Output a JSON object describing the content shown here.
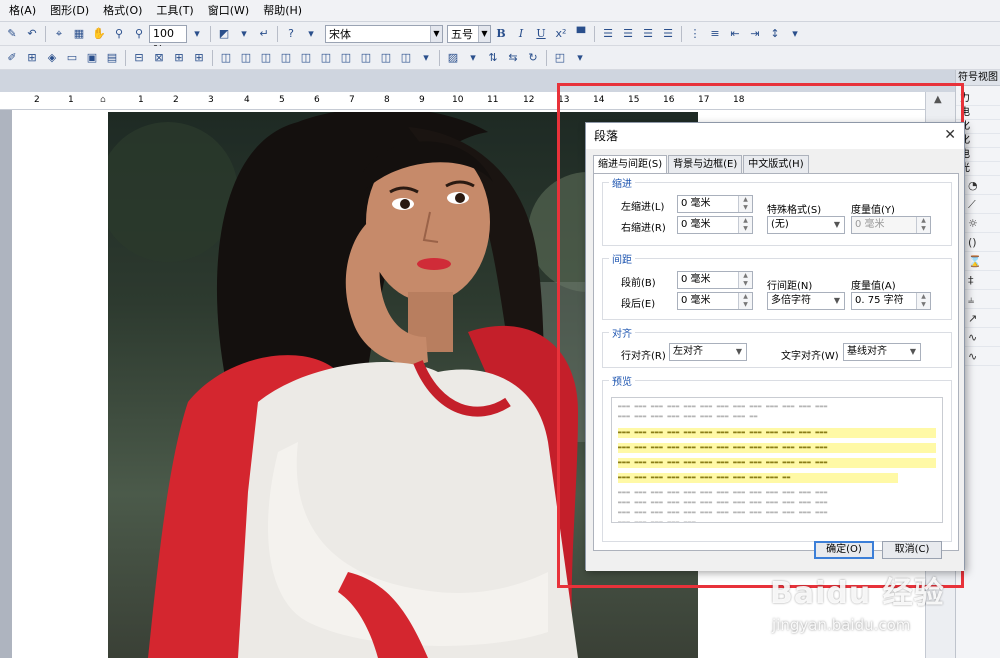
{
  "menu": [
    "格(A)",
    "图形(D)",
    "格式(O)",
    "工具(T)",
    "窗口(W)",
    "帮助(H)"
  ],
  "toolbar": {
    "zoom": "100 %",
    "font_name": "宋体",
    "font_size": "五号",
    "bold": "B",
    "italic": "I",
    "underline": "U"
  },
  "ruler_ticks": [
    "2",
    "1",
    "",
    "1",
    "2",
    "3",
    "4",
    "5",
    "6",
    "7",
    "8",
    "9",
    "10",
    "11",
    "12",
    "13",
    "14",
    "15",
    "16",
    "17",
    "18"
  ],
  "right_panel": {
    "title": "符号视图",
    "items": [
      "力",
      "电",
      "化",
      "化",
      "电",
      "光"
    ]
  },
  "dialog": {
    "title": "段落",
    "tabs": [
      "缩进与间距(S)",
      "背景与边框(E)",
      "中文版式(H)"
    ],
    "indent": {
      "group": "缩进",
      "left_label": "左缩进(L)",
      "left_value": "0 毫米",
      "right_label": "右缩进(R)",
      "right_value": "0 毫米",
      "special_label": "特殊格式(S)",
      "special_value": "(无)",
      "measure_label": "度量值(Y)",
      "measure_value": "0 毫米"
    },
    "spacing": {
      "group": "间距",
      "before_label": "段前(B)",
      "before_value": "0 毫米",
      "after_label": "段后(E)",
      "after_value": "0 毫米",
      "line_label": "行间距(N)",
      "line_value": "多倍字符",
      "measure_label": "度量值(A)",
      "measure_value": "0. 75 字符"
    },
    "align": {
      "group": "对齐",
      "line_align_label": "行对齐(R)",
      "line_align_value": "左对齐",
      "text_align_label": "文字对齐(W)",
      "text_align_value": "基线对齐"
    },
    "preview": {
      "group": "预览"
    },
    "ok": "确定(O)",
    "cancel": "取消(C)"
  },
  "watermark": {
    "line1": "Baidu 经验",
    "line2": "jingyan.baidu.com"
  },
  "colors": {
    "highlight_red": "#e8323a",
    "accent_blue": "#1e55b0",
    "preview_yellow": "#fff9a6"
  }
}
